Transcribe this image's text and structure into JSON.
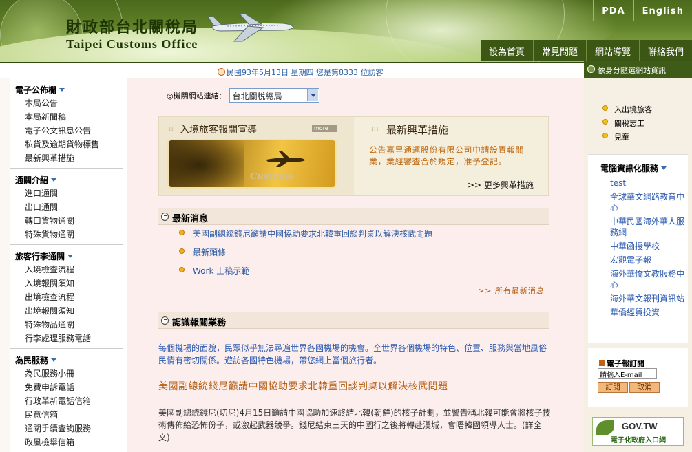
{
  "header": {
    "title_zh": "財政部台北關稅局",
    "title_en": "Taipei Customs Office",
    "top_links": [
      "PDA",
      "English"
    ],
    "nav": [
      "設為首頁",
      "常見問題",
      "網站導覽",
      "聯絡我們"
    ]
  },
  "status": {
    "text": "民國93年5月13日 星期四 您是第8333 位訪客"
  },
  "right": {
    "top_label": "依身分隨選網站資訊",
    "quick_links": [
      "入出境旅客",
      "關稅志工",
      "兒童"
    ],
    "edu_title": "電腦資訊化服務",
    "edu_links": [
      "test",
      "全球華文網路教育中心",
      "中華民國海外華人服務網",
      "中華函授學校",
      "宏觀電子報",
      "海外華僑文教服務中心",
      "海外華文報刊資訊站",
      "華僑經貿投資"
    ],
    "epaper_title": "電子報訂閱",
    "epaper_placeholder": "請輸入E-mail",
    "subscribe_label": "訂閱",
    "unsubscribe_label": "取消",
    "gov_text1": "GOV.TW",
    "gov_text2": "電子化政府入口網"
  },
  "sidebar": {
    "sections": [
      {
        "title": "電子公佈欄",
        "items": [
          "本局公告",
          "本局新聞稿",
          "電子公文訊息公告",
          "私貨及逾期貨物標售",
          "最新興革措施"
        ]
      },
      {
        "title": "通關介紹",
        "items": [
          "進口通關",
          "出口通關",
          "轉口貨物通關",
          "特殊貨物通關"
        ]
      },
      {
        "title": "旅客行李通關",
        "items": [
          "入境檢查流程",
          "入境報關須知",
          "出境檢查流程",
          "出境報關須知",
          "特殊物品通關",
          "行李處理服務電話"
        ]
      },
      {
        "title": "為民服務",
        "items": [
          "為民服務小冊",
          "免費申訴電話",
          "行政革新電話信箱",
          "民意信箱",
          "通關手續查詢服務",
          "政風檢舉信箱"
        ]
      }
    ]
  },
  "content": {
    "agency_label": "◎機關網站連結：",
    "agency_selected": "台北關稅總局",
    "promo": {
      "left_title": "入境旅客報關宣導",
      "more_label": "more",
      "banner_word": "Customs",
      "right_title": "最新興革措施",
      "notice": "公告嘉里通運股份有限公司申請設置報關業，業經審查合於規定，准予登記。",
      "more_link": ">> 更多興革措施"
    },
    "news_title": "最新消息",
    "news_items": [
      "美國副總統錢尼籲請中國協助要求北韓重回談判桌以解決核武問題",
      "最新頭條",
      "Work 上稿示範"
    ],
    "all_news": ">> 所有最新消息",
    "business_title": "認識報關業務",
    "intro": "每個機場的面貌，民眾似乎無法尋遍世界各國機場的機會。全世界各個機場的特色、位置、服務與當地風俗民情有密切關係。遊訪各國特色機場，帶您網上當個旅行者。",
    "headline": "美國副總統錢尼籲請中國協助要求北韓重回談判桌以解決核武問題",
    "article": "美國副總統錢尼(切尼)4月15日籲請中國協助加速終結北韓(朝鮮)的核子計劃，並警告稱北韓可能會將核子技術傳佈給恐怖份子，或激起武器競爭。錢尼結束三天的中國行之後將轉赴漢城，會晤韓國領導人士。(詳全文)"
  },
  "colors": {
    "header_green": "#4c6a1c",
    "content_bg": "#fdeeee",
    "link_blue": "#2a5ab0",
    "accent_orange": "#c06a14"
  }
}
